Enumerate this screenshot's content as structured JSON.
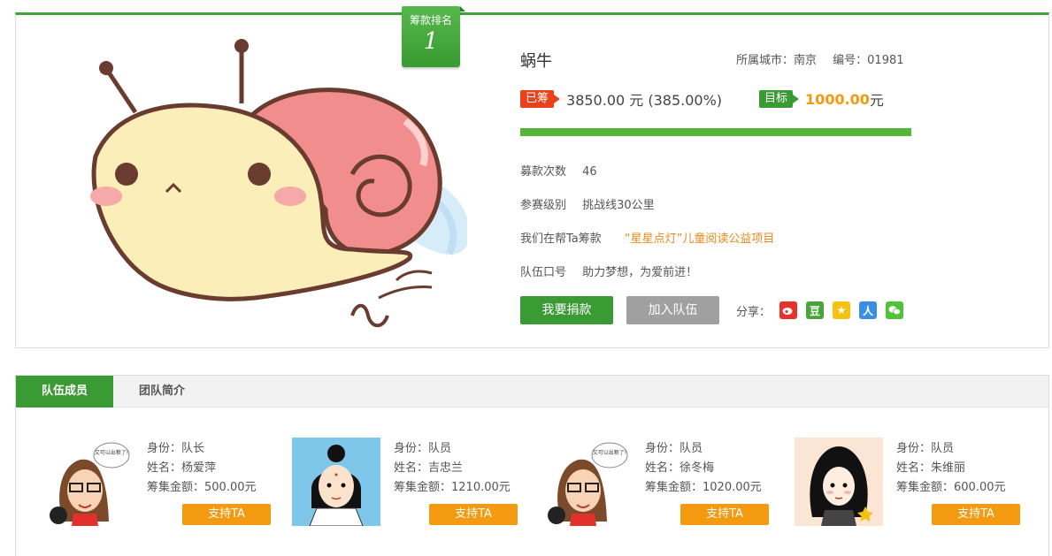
{
  "header": {
    "rank_caption": "筹款排名",
    "rank_number": "1"
  },
  "team": {
    "name": "蜗牛",
    "city_label": "所属城市：南京",
    "id_label": "编号：01981",
    "raised_tag": "已筹",
    "raised_text": "3850.00 元 (385.00%)",
    "target_tag": "目标",
    "target_value": "1000.00",
    "target_unit": "元",
    "progress_fraction": 1.0,
    "donation_count_label": "募款次数",
    "donation_count_value": "46",
    "level_label": "参赛级别",
    "level_value": "挑战线30公里",
    "help_label": "我们在帮Ta筹款",
    "help_value": "“星星点灯”儿童阅读公益项目",
    "slogan_label": "队伍口号",
    "slogan_value": "助力梦想，为爱前进！",
    "donate_button": "我要捐款",
    "join_button": "加入队伍",
    "share_label": "分享：",
    "share_icons": [
      "weibo-icon",
      "douban-icon",
      "qzone-icon",
      "renren-icon",
      "wechat-icon"
    ]
  },
  "tabs": [
    {
      "label": "队伍成员",
      "active": true
    },
    {
      "label": "团队简介",
      "active": false
    }
  ],
  "members": [
    {
      "role": "身份：队长",
      "name": "姓名：杨爱萍",
      "amount": "筹集金额：500.00元",
      "support": "支持TA",
      "bubble": "又可以出粮了!"
    },
    {
      "role": "身份：队员",
      "name": "姓名：吉忠兰",
      "amount": "筹集金额：1210.00元",
      "support": "支持TA"
    },
    {
      "role": "身份：队员",
      "name": "姓名：徐冬梅",
      "amount": "筹集金额：1020.00元",
      "support": "支持TA",
      "bubble": "又可以出粮了!"
    },
    {
      "role": "身份：队员",
      "name": "姓名：朱维丽",
      "amount": "筹集金额：600.00元",
      "support": "支持TA"
    }
  ],
  "colors": {
    "brand_green": "#3a9a33",
    "accent_orange": "#f39a11",
    "raised_red": "#e8411b"
  }
}
